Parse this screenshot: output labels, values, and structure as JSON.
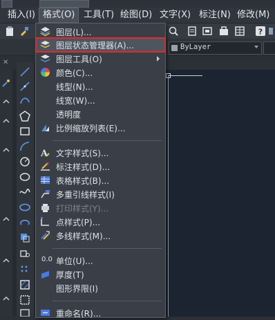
{
  "menubar": {
    "items": [
      {
        "label": "插入(I)"
      },
      {
        "label": "格式(O)"
      },
      {
        "label": "工具(T)"
      },
      {
        "label": "绘图(D)"
      },
      {
        "label": "文字(X)"
      },
      {
        "label": "标注(N)"
      },
      {
        "label": "修改(M)"
      }
    ],
    "active_index": 1
  },
  "toolbar": {
    "bylayer_value": "ByLayer"
  },
  "format_menu": {
    "items": [
      {
        "label": "图层(L)...",
        "icon": "layers-icon"
      },
      {
        "label": "图层状态管理器(A)...",
        "icon": "layer-state-icon",
        "highlighted": true
      },
      {
        "label": "图层工具(O)",
        "icon": "layer-tools-icon",
        "submenu": true
      },
      {
        "label": "颜色(C)...",
        "icon": "color-wheel-icon"
      },
      {
        "label": "线型(N)..."
      },
      {
        "label": "线宽(W)..."
      },
      {
        "label": "透明度"
      },
      {
        "label": "比例缩放列表(E)...",
        "icon": "scale-list-icon"
      },
      {
        "label": "文字样式(S)...",
        "icon": "text-style-icon"
      },
      {
        "label": "标注样式(D)...",
        "icon": "dim-style-icon"
      },
      {
        "label": "表格样式(B)...",
        "icon": "table-style-icon"
      },
      {
        "label": "多重引线样式(I)",
        "icon": "mleader-style-icon"
      },
      {
        "label": "打印样式(Y)...",
        "icon": "plot-style-icon",
        "disabled": true
      },
      {
        "label": "点样式(P)...",
        "icon": "point-style-icon"
      },
      {
        "label": "多线样式(M)...",
        "icon": "mline-style-icon"
      },
      {
        "label": "单位(U)...",
        "prefix": "0.0"
      },
      {
        "label": "厚度(T)",
        "icon": "thickness-icon"
      },
      {
        "label": "图形界限(I)"
      },
      {
        "label": "重命名(R)...",
        "icon": "rename-icon"
      }
    ]
  },
  "colors": {
    "accent_highlight_border": "#e12b2b",
    "menu_bg": "#3a3f47",
    "canvas_bg": "#1b2430"
  }
}
